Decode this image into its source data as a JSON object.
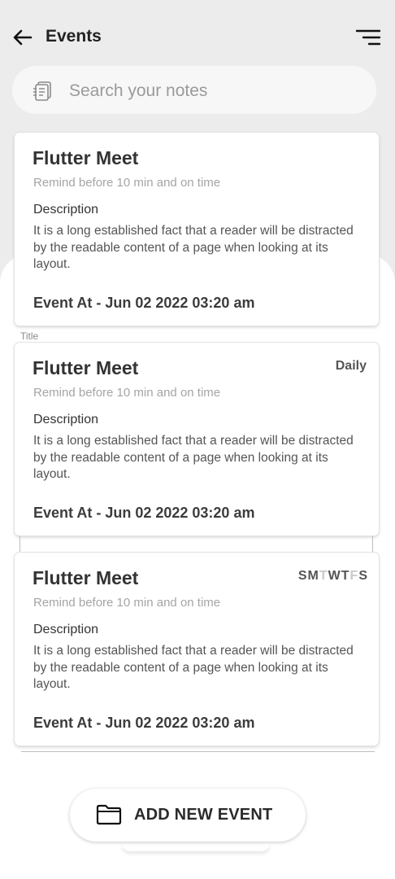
{
  "header": {
    "title": "Events",
    "back_icon": "arrow-left-icon",
    "menu_icon": "sort-menu-icon"
  },
  "search": {
    "placeholder": "Search your notes",
    "icon": "notes-stack-icon"
  },
  "ghost_label": "Title",
  "cards": [
    {
      "title": "Flutter Meet",
      "remind": "Remind before 10 min and on time",
      "description_heading": "Description",
      "description": "It is a long established fact that a reader will be distracted by the readable content of a page when looking at its layout.",
      "event_at": "Event At - Jun 02 2022 03:20 am"
    },
    {
      "title": "Flutter Meet",
      "repeat": "Daily",
      "remind": "Remind before 10 min and on time",
      "description_heading": "Description",
      "description": "It is a long established fact that a reader will be distracted by the readable content of a page when looking at its layout.",
      "event_at": "Event At - Jun 02 2022 03:20 am"
    },
    {
      "title": "Flutter Meet",
      "days": [
        {
          "letter": "S",
          "active": true
        },
        {
          "letter": "M",
          "active": true
        },
        {
          "letter": "T",
          "active": false
        },
        {
          "letter": "W",
          "active": true
        },
        {
          "letter": "T",
          "active": true
        },
        {
          "letter": "F",
          "active": false
        },
        {
          "letter": "S",
          "active": true
        }
      ],
      "remind": "Remind before 10 min and on time",
      "description_heading": "Description",
      "description": "It is a long established fact that a reader will be distracted by the readable content of a page when looking at its layout.",
      "event_at": "Event At - Jun 02 2022 03:20 am"
    }
  ],
  "add_button": {
    "label": "ADD NEW EVENT",
    "icon": "folder-icon"
  },
  "colors": {
    "background": "#ececec",
    "surface": "#ffffff",
    "text": "#2b2b2b",
    "muted": "#a5a5a5",
    "day_inactive": "#c9c9c9"
  }
}
